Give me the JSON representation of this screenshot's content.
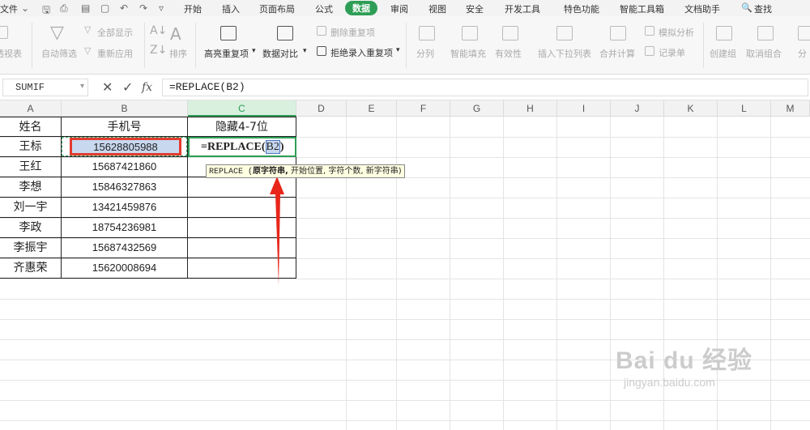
{
  "menu": {
    "file": "文件",
    "tabs": [
      "开始",
      "插入",
      "页面布局",
      "公式",
      "数据",
      "审阅",
      "视图",
      "安全",
      "开发工具",
      "特色功能",
      "智能工具箱",
      "文档助手"
    ],
    "active_tab": "数据",
    "search": "查找",
    "accent": "#2e9e56"
  },
  "ribbon": {
    "pivot_partial": "透视表",
    "auto_filter": "自动筛选",
    "show_all": "全部显示",
    "reapply": "重新应用",
    "sort": "排序",
    "highlight_dup": "高亮重复项",
    "data_compare": "数据对比",
    "delete_dup": "删除重复项",
    "reject_dup": "拒绝录入重复项",
    "split": "分列",
    "smart_fill": "智能填充",
    "validity": "有效性",
    "insert_dropdown": "插入下拉列表",
    "merge_calc": "合并计算",
    "simulate": "模拟分析",
    "record": "记录单",
    "create_group": "创建组",
    "ungroup": "取消组合",
    "subtotal_partial": "分"
  },
  "formula_bar": {
    "name_box": "SUMIF",
    "cancel": "✕",
    "enter": "✓",
    "fx": "fx",
    "formula": "=REPLACE(B2)"
  },
  "columns": [
    "A",
    "B",
    "C",
    "D",
    "E",
    "F",
    "G",
    "H",
    "I",
    "J",
    "K",
    "L",
    "M"
  ],
  "table": {
    "headers": [
      "姓名",
      "手机号",
      "隐藏4-7位"
    ],
    "rows": [
      {
        "name": "王标",
        "phone": "15628805988"
      },
      {
        "name": "王红",
        "phone": "15687421860"
      },
      {
        "name": "李想",
        "phone": "15846327863"
      },
      {
        "name": "刘一宇",
        "phone": "13421459876"
      },
      {
        "name": "李政",
        "phone": "18754236981"
      },
      {
        "name": "李振宇",
        "phone": "15687432569"
      },
      {
        "name": "齐惠荣",
        "phone": "15620008694"
      }
    ],
    "editing_cell_formula": "=REPLACE(",
    "editing_cell_ref": "B2",
    "editing_cell_close": ")"
  },
  "tooltip": {
    "func": "REPLACE (",
    "arg_active": "原字符串,",
    "args_rest": " 开始位置, 字符个数, 新字符串)"
  },
  "watermark": {
    "brand": "Bai du 经验",
    "url": "jingyan.baidu.com"
  }
}
